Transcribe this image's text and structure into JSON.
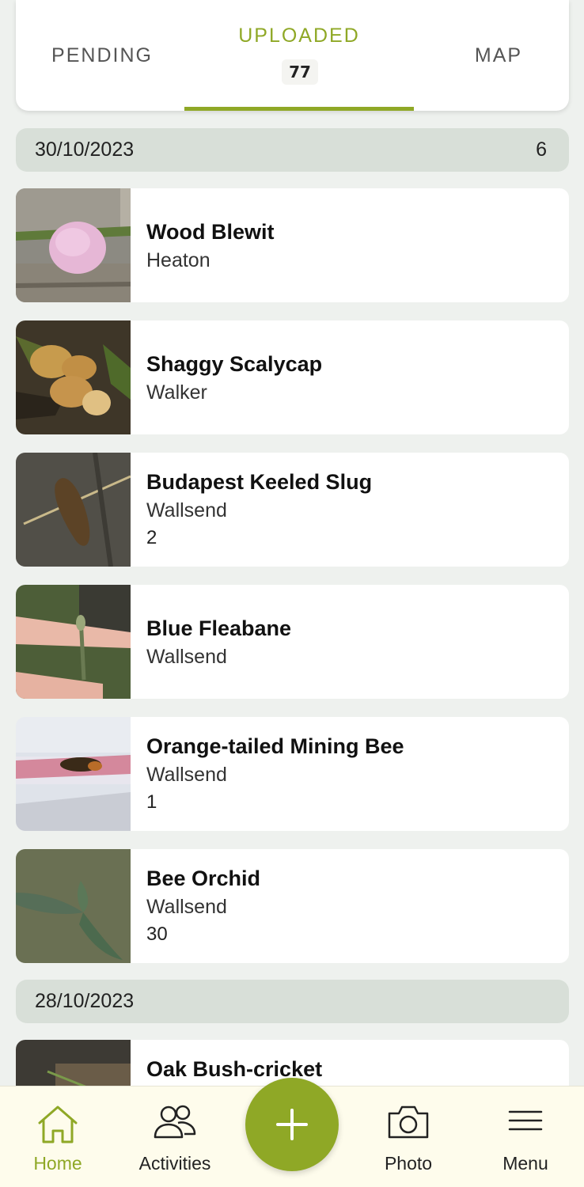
{
  "tabs": {
    "pending": "PENDING",
    "uploaded": "UPLOADED",
    "uploaded_count": "77",
    "map": "MAP"
  },
  "groups": [
    {
      "date": "30/10/2023",
      "count": "6",
      "records": [
        {
          "title": "Wood Blewit",
          "place": "Heaton",
          "count": ""
        },
        {
          "title": "Shaggy Scalycap",
          "place": "Walker",
          "count": ""
        },
        {
          "title": "Budapest Keeled Slug",
          "place": "Wallsend",
          "count": "2"
        },
        {
          "title": "Blue Fleabane",
          "place": "Wallsend",
          "count": ""
        },
        {
          "title": "Orange-tailed Mining Bee",
          "place": "Wallsend",
          "count": "1"
        },
        {
          "title": "Bee Orchid",
          "place": "Wallsend",
          "count": "30"
        }
      ]
    },
    {
      "date": "28/10/2023",
      "count": "",
      "records": [
        {
          "title": "Oak Bush-cricket",
          "place": "",
          "count": ""
        }
      ]
    }
  ],
  "nav": {
    "home": "Home",
    "activities": "Activities",
    "photo": "Photo",
    "menu": "Menu"
  },
  "icons": {
    "home": "home-icon",
    "activities": "people-icon",
    "add": "plus-icon",
    "photo": "camera-icon",
    "menu": "hamburger-icon"
  },
  "colors": {
    "accent": "#8fa826",
    "background": "#eef1ee",
    "date_header": "#d8dfd8",
    "nav_background": "#fefcec"
  }
}
